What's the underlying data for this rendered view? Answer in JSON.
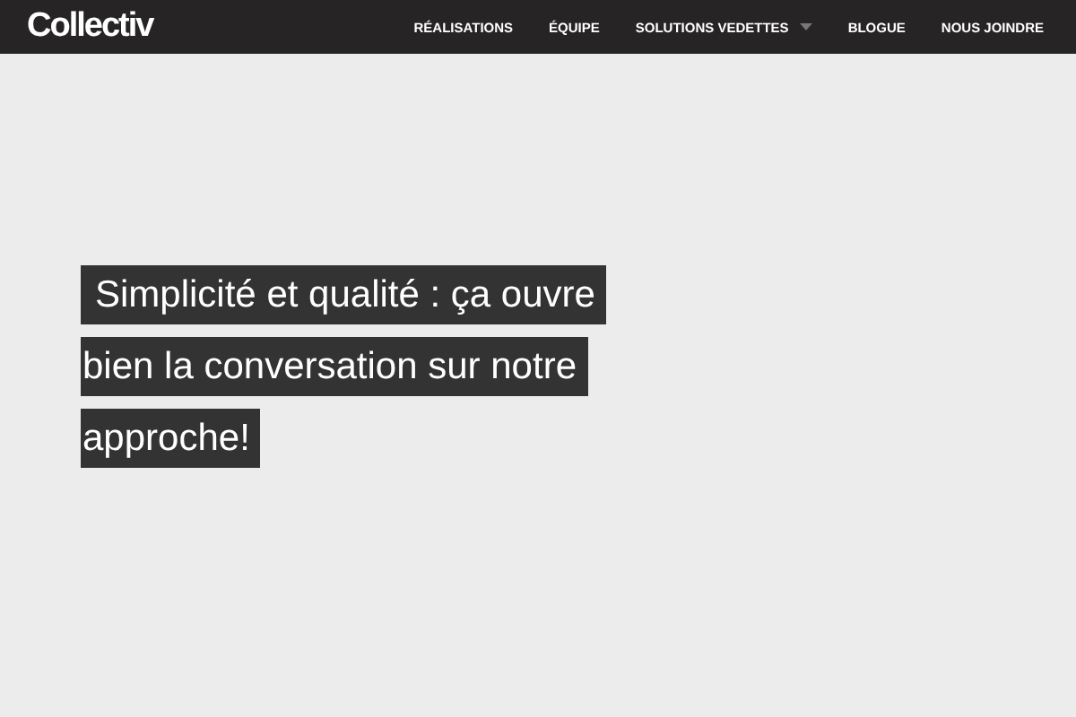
{
  "header": {
    "logo": "Collectiv",
    "nav": [
      {
        "label": "RÉALISATIONS",
        "dropdown": false
      },
      {
        "label": "ÉQUIPE",
        "dropdown": false
      },
      {
        "label": "SOLUTIONS VEDETTES",
        "dropdown": true
      },
      {
        "label": "BLOGUE",
        "dropdown": false
      },
      {
        "label": "NOUS JOINDRE",
        "dropdown": false
      }
    ]
  },
  "hero": {
    "headline_lines": [
      "Simplicité et qualité : ça ouvre",
      "bien la conversation sur notre",
      "approche!"
    ]
  }
}
